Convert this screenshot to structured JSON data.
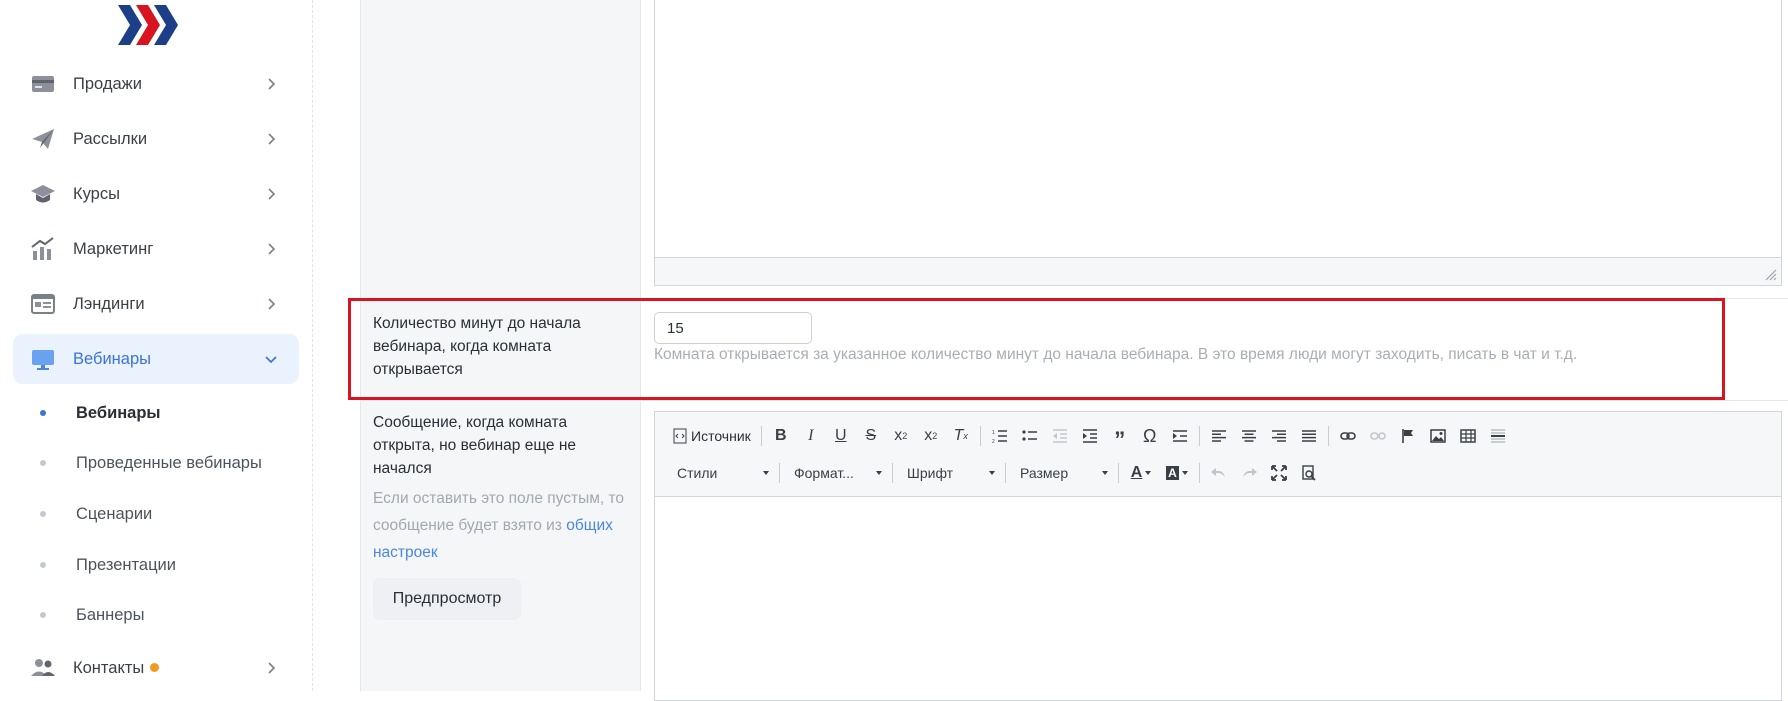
{
  "sidebar": {
    "items": [
      {
        "label": "Продажи",
        "icon": "card-icon"
      },
      {
        "label": "Рассылки",
        "icon": "paper-plane-icon"
      },
      {
        "label": "Курсы",
        "icon": "graduation-cap-icon"
      },
      {
        "label": "Маркетинг",
        "icon": "bar-chart-icon"
      },
      {
        "label": "Лэндинги",
        "icon": "landing-page-icon"
      },
      {
        "label": "Вебинары",
        "icon": "monitor-icon"
      },
      {
        "label": "Контакты",
        "icon": "users-icon"
      }
    ],
    "subitems": [
      "Вебинары",
      "Проведенные вебинары",
      "Сценарии",
      "Презентации",
      "Баннеры"
    ]
  },
  "form": {
    "minutes_label": "Количество минут до начала вебинара, когда комната открывается",
    "minutes_value": "15",
    "minutes_help": "Комната открывается за указанное количество минут до начала вебинара. В это время люди могут заходить, писать в чат и т.д.",
    "message_label": "Сообщение, когда комната открыта, но вебинар еще не начался",
    "message_hint": "Если оставить это поле пустым, то сообщение будет взято из",
    "message_hint_link": "общих настроек",
    "preview_button": "Предпросмотр"
  },
  "editor": {
    "source_label": "Источник",
    "styles": "Стили",
    "format": "Формат...",
    "font": "Шрифт",
    "size": "Размер"
  },
  "colors": {
    "accent": "#3a73d9",
    "highlight": "#d7141f",
    "badge": "#f39a1c"
  }
}
